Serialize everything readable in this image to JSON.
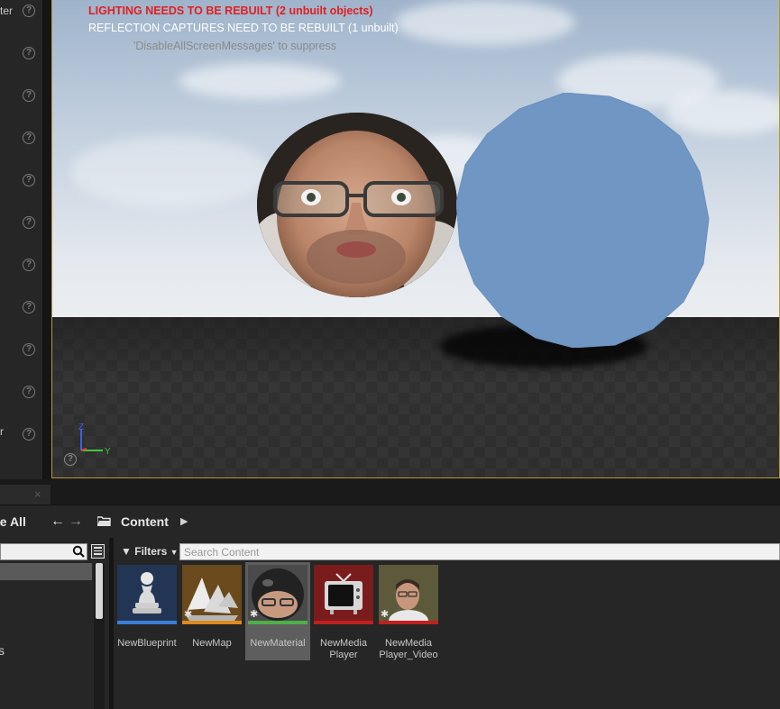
{
  "details_panel": {
    "labels": [
      "ter",
      "r"
    ],
    "help_icon_glyph": "?"
  },
  "viewport": {
    "messages": {
      "lighting": "LIGHTING NEEDS TO BE REBUILT (2 unbuilt objects)",
      "reflection": "REFLECTION CAPTURES NEED TO BE REBUILT (1 unbuilt)",
      "suppress": "'DisableAllScreenMessages' to suppress"
    },
    "axis": {
      "z": "Z",
      "y": "Y"
    },
    "colors": {
      "warning": "#e02020",
      "selection_border": "#b8962e",
      "sphere": "#7096c4"
    }
  },
  "content_browser": {
    "tab_close": "×",
    "save_all_label": "ve All",
    "breadcrumb": "Content",
    "filters_label": "Filters",
    "search": {
      "placeholder": "Search Content",
      "value": ""
    },
    "sources_item": "s",
    "assets": [
      {
        "name": "NewBlueprint",
        "type": "blueprint",
        "bar_color": "#3c7fd6",
        "selected": false
      },
      {
        "name": "NewMap",
        "type": "map",
        "bar_color": "#e08a1e",
        "selected": false
      },
      {
        "name": "NewMaterial",
        "type": "material",
        "bar_color": "#4fb04a",
        "selected": true
      },
      {
        "name": "NewMedia Player",
        "type": "media-player",
        "bar_color": "#c02020",
        "selected": false
      },
      {
        "name": "NewMedia Player_Video",
        "type": "media-texture",
        "bar_color": "#c02020",
        "selected": false
      }
    ]
  }
}
